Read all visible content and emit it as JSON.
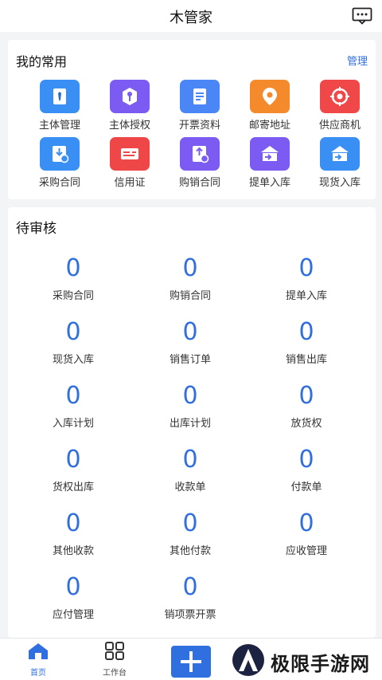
{
  "header": {
    "title": "木管家",
    "message_icon": "message-icon"
  },
  "favorites": {
    "title": "我的常用",
    "manage_label": "管理",
    "items": [
      {
        "label": "主体管理",
        "icon": "tie-icon",
        "color": "#3a8ff5"
      },
      {
        "label": "主体授权",
        "icon": "key-icon",
        "color": "#7b5bf2"
      },
      {
        "label": "开票资料",
        "icon": "document-icon",
        "color": "#4a86f5"
      },
      {
        "label": "邮寄地址",
        "icon": "location-icon",
        "color": "#f58a2c"
      },
      {
        "label": "供应商机",
        "icon": "target-icon",
        "color": "#f04848"
      },
      {
        "label": "采购合同",
        "icon": "contract-download-icon",
        "color": "#3a8ff5"
      },
      {
        "label": "信用证",
        "icon": "card-icon",
        "color": "#ef4747"
      },
      {
        "label": "购销合同",
        "icon": "contract-upload-icon",
        "color": "#7b5bf2"
      },
      {
        "label": "提单入库",
        "icon": "warehouse-in-icon",
        "color": "#7b5bf2"
      },
      {
        "label": "现货入库",
        "icon": "warehouse-in-icon",
        "color": "#3a8ff5"
      }
    ]
  },
  "pending": {
    "title": "待审核",
    "items": [
      {
        "value": "0",
        "label": "采购合同"
      },
      {
        "value": "0",
        "label": "购销合同"
      },
      {
        "value": "0",
        "label": "提单入库"
      },
      {
        "value": "0",
        "label": "现货入库"
      },
      {
        "value": "0",
        "label": "销售订单"
      },
      {
        "value": "0",
        "label": "销售出库"
      },
      {
        "value": "0",
        "label": "入库计划"
      },
      {
        "value": "0",
        "label": "出库计划"
      },
      {
        "value": "0",
        "label": "放货权"
      },
      {
        "value": "0",
        "label": "货权出库"
      },
      {
        "value": "0",
        "label": "收款单"
      },
      {
        "value": "0",
        "label": "付款单"
      },
      {
        "value": "0",
        "label": "其他收款"
      },
      {
        "value": "0",
        "label": "其他付款"
      },
      {
        "value": "0",
        "label": "应收管理"
      },
      {
        "value": "0",
        "label": "应付管理"
      },
      {
        "value": "0",
        "label": "销项票开票"
      }
    ]
  },
  "nav": {
    "home_label": "首页",
    "work_label": "工作台"
  },
  "watermark": {
    "text": "极限手游网"
  },
  "colors": {
    "accent": "#2f6fe0",
    "background": "#f3f4f6"
  }
}
